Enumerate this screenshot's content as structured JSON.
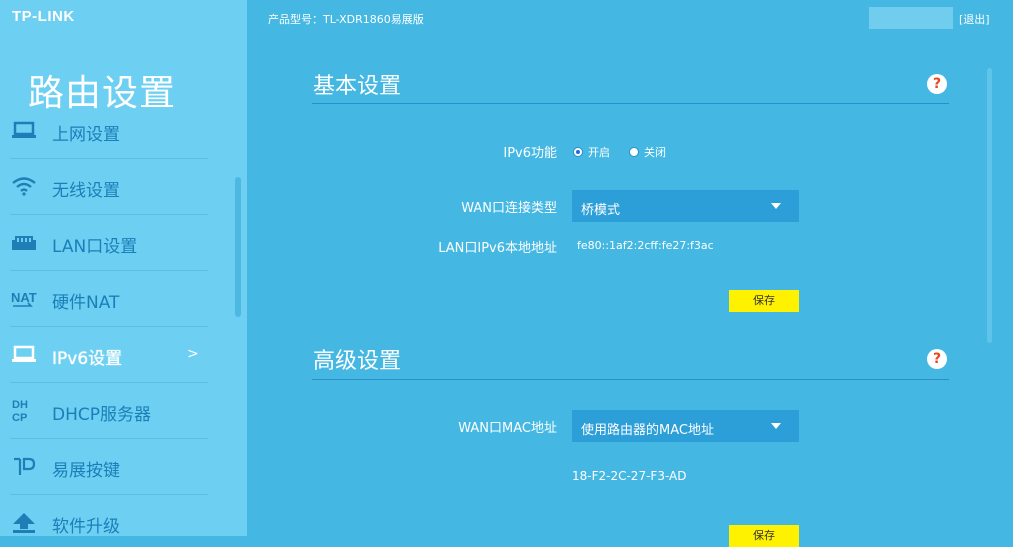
{
  "header": {
    "logo": "TP-LINK",
    "model_text": "产品型号：TL-XDR1860易展版",
    "logout": "[退出]"
  },
  "sidebar": {
    "title": "路由设置",
    "items": [
      {
        "label": "上网设置",
        "icon": "laptop-icon"
      },
      {
        "label": "无线设置",
        "icon": "wifi-icon"
      },
      {
        "label": "LAN口设置",
        "icon": "lan-port-icon"
      },
      {
        "label": "硬件NAT",
        "icon": "nat-icon"
      },
      {
        "label": "IPv6设置",
        "icon": "laptop-icon",
        "active": true,
        "arrow": ">"
      },
      {
        "label": "DHCP服务器",
        "icon": "dhcp-icon"
      },
      {
        "label": "易展按键",
        "icon": "easymesh-icon"
      },
      {
        "label": "软件升级",
        "icon": "upgrade-icon"
      }
    ]
  },
  "basic": {
    "title": "基本设置",
    "help": "?",
    "ipv6_label": "IPv6功能",
    "radio_on": "开启",
    "radio_off": "关闭",
    "ipv6_enabled": true,
    "wan_type_label": "WAN口连接类型",
    "wan_type_value": "桥模式",
    "lan_ipv6_label": "LAN口IPv6本地地址",
    "lan_ipv6_value": "fe80::1af2:2cff:fe27:f3ac",
    "save": "保存"
  },
  "advanced": {
    "title": "高级设置",
    "help": "?",
    "mac_label": "WAN口MAC地址",
    "mac_select": "使用路由器的MAC地址",
    "mac_value": "18-F2-2C-27-F3-AD",
    "save": "保存"
  },
  "colors": {
    "main_bg": "#44b8e3",
    "sidebar_bg": "#6dd0f2",
    "accent_line": "#2a8fcc",
    "save_button": "#fff200",
    "help_q": "#e7491e"
  }
}
